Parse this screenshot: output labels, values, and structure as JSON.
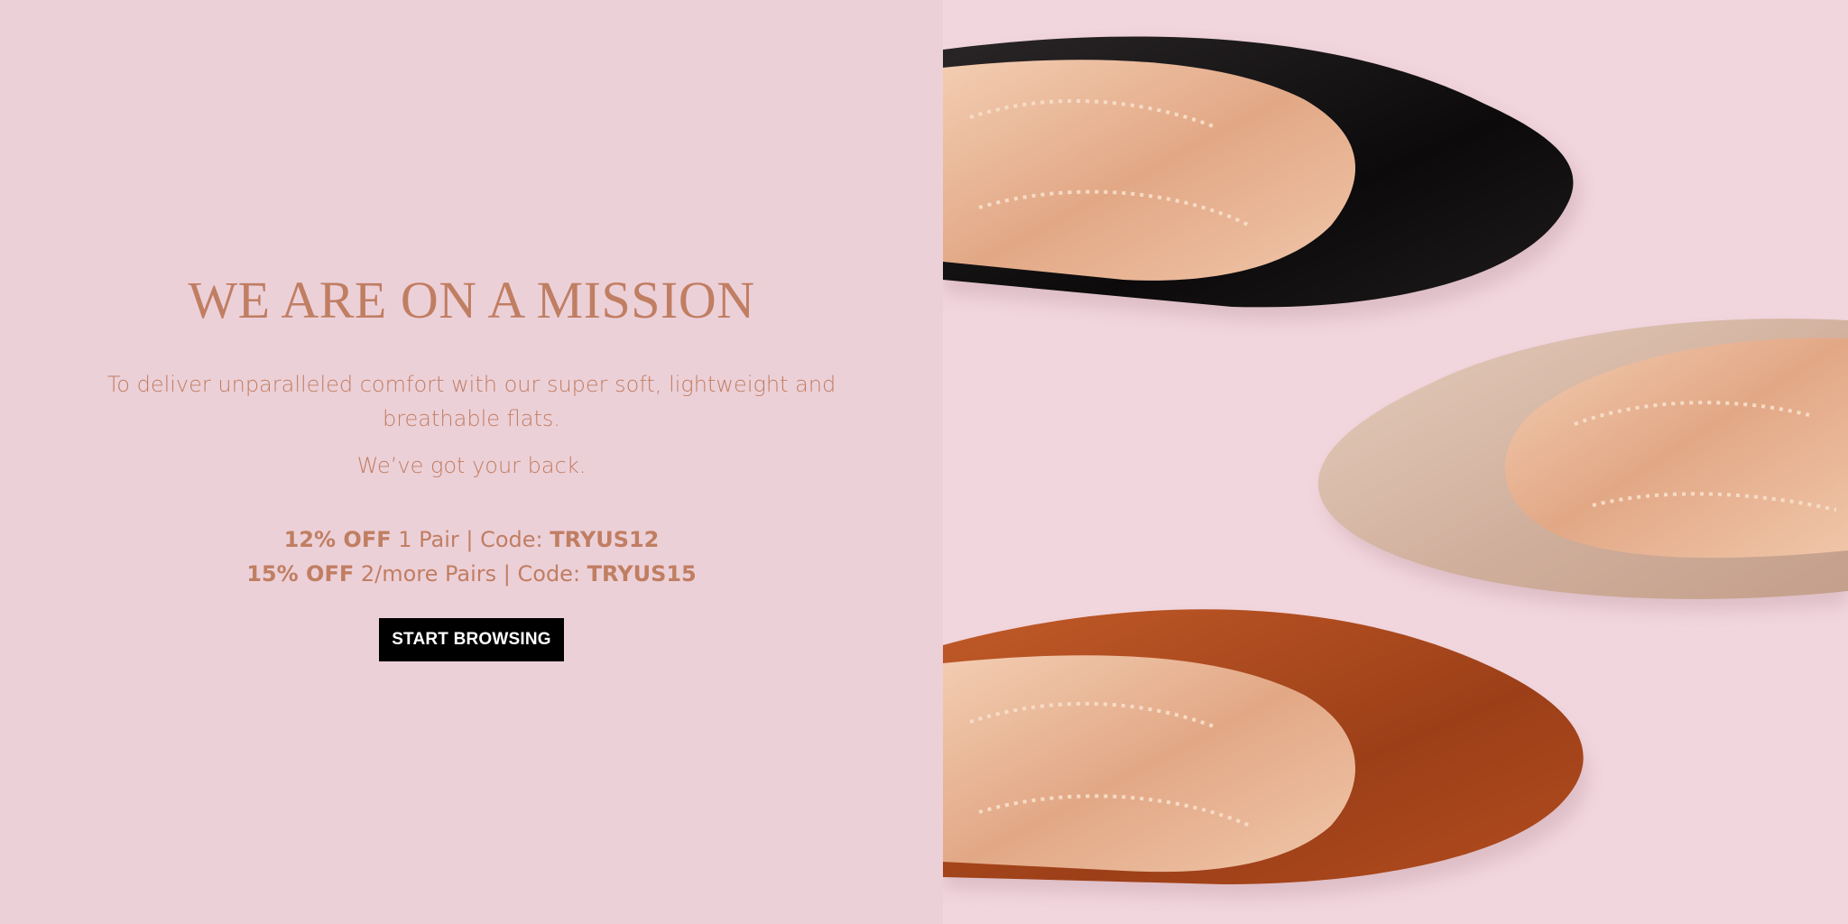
{
  "hero": {
    "headline": "WE ARE ON A MISSION",
    "description": "To deliver unparalleled comfort with our super soft, lightweight and breathable flats.",
    "tagline": "We’ve got your back.",
    "offers": [
      {
        "discount": "12% OFF",
        "detail": " 1 Pair | Code: ",
        "code": "TRYUS12"
      },
      {
        "discount": "15% OFF",
        "detail": " 2/more Pairs | Code: ",
        "code": "TRYUS15"
      }
    ],
    "cta_label": "START BROWSING"
  },
  "image": {
    "subject": "three-pointed-flats-black-nude-cognac",
    "colors": {
      "background": "#ecd0d8",
      "accent_text": "#c07e62",
      "cta_bg": "#000000",
      "cta_text": "#ffffff",
      "shoe_black": "#141214",
      "shoe_nude": "#d6b8a6",
      "shoe_cognac": "#a9471c",
      "insole": "#e8b596"
    }
  }
}
